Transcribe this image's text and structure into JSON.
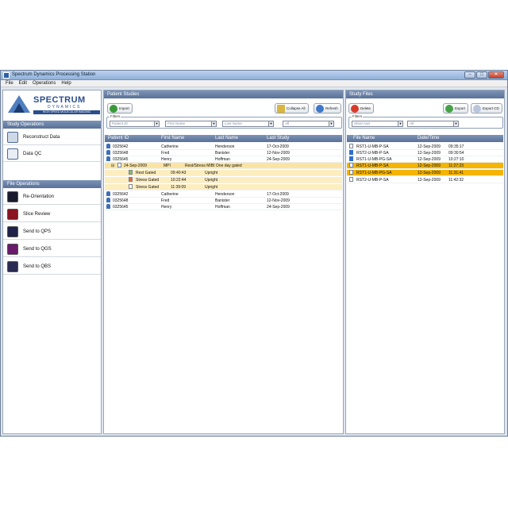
{
  "window": {
    "title": "Spectrum Dynamics Processing Station",
    "controls": [
      "–",
      "□",
      "✕"
    ]
  },
  "menu": [
    "File",
    "Edit",
    "Operations",
    "Help"
  ],
  "logo": {
    "brand": "SPECTRUM",
    "sub": "DYNAMICS",
    "tag": "HIGH SPEED MOLECULAR IMAGING"
  },
  "sidebar": {
    "study_ops_title": "Study Operations",
    "study_ops": [
      {
        "label": "Reconstruct Data",
        "icon": "reconstruct-icon"
      },
      {
        "label": "Data QC",
        "icon": "chart-icon"
      }
    ],
    "file_ops_title": "File Operations",
    "file_ops": [
      {
        "label": "Re-Orientation",
        "icon": "reorientation-icon"
      },
      {
        "label": "Slice Review",
        "icon": "slice-review-icon"
      },
      {
        "label": "Send to QPS",
        "icon": "qps-icon"
      },
      {
        "label": "Send to QGS",
        "icon": "qgs-icon"
      },
      {
        "label": "Send to QBS",
        "icon": "qbs-icon"
      }
    ]
  },
  "patients": {
    "title": "Patient Studies",
    "import_label": "Import",
    "collapse_label": "Collapse All",
    "refresh_label": "Refresh",
    "filters_label": "Filters",
    "filters": [
      "Patient ID",
      "First Name",
      "Last Name",
      "All"
    ],
    "columns": [
      "Patient ID",
      "First Name",
      "Last Name",
      "Last Study"
    ],
    "rows_top": [
      [
        "0325642",
        "Catherine",
        "Henderson",
        "17-Oct-2009"
      ],
      [
        "0325648",
        "Fred",
        "Banister",
        "12-Nov-2009"
      ],
      [
        "0325645",
        "Henry",
        "Hoffman",
        "24-Sep-2009"
      ]
    ],
    "study": {
      "date": "24-Sep-2009",
      "type": "MPI",
      "desc": "Rest/Stress MIBI One day gated"
    },
    "series": [
      [
        "Rest Gated",
        "09:40:43",
        "Upright"
      ],
      [
        "Stress Gated",
        "10:22:44",
        "Upright"
      ],
      [
        "Stress Gated",
        "11:39:09",
        "Upright"
      ]
    ],
    "rows_bottom": [
      [
        "0325642",
        "Catherine",
        "Henderson",
        "17-Oct-2009"
      ],
      [
        "0325648",
        "Fred",
        "Banister",
        "12-Nov-2009"
      ],
      [
        "0325645",
        "Henry",
        "Hoffman",
        "24-Sep-2009"
      ]
    ]
  },
  "files": {
    "title": "Study Files",
    "delete_label": "Delete",
    "export_label": "Export",
    "export_cd_label": "Export CD",
    "filters_label": "Filters",
    "filters": [
      "Short Axis",
      "All"
    ],
    "columns": [
      "File Name",
      "Date/Time"
    ],
    "rows": [
      [
        "RST1-U-MB-P-SA",
        "12-Sep-2009",
        "09:35:17"
      ],
      [
        "RST2-U-MB-P-SA",
        "12-Sep-2009",
        "09:30:54"
      ],
      [
        "RST1-U-MB-PG-SA",
        "12-Sep-2009",
        "10:27:10"
      ],
      [
        "RST1-U-MB-P-SA",
        "12-Sep-2009",
        "11:27:23"
      ],
      [
        "RST1-U-MB-PG-SA",
        "12-Sep-2009",
        "11:31:41"
      ],
      [
        "RST2-U-MB-P-SA",
        "12-Sep-2009",
        "11:42:32"
      ]
    ]
  },
  "colors": {
    "header": "#5a7198",
    "selection": "#f4b400",
    "study_row": "#fbe4a2",
    "brand": "#2a4f8c"
  }
}
